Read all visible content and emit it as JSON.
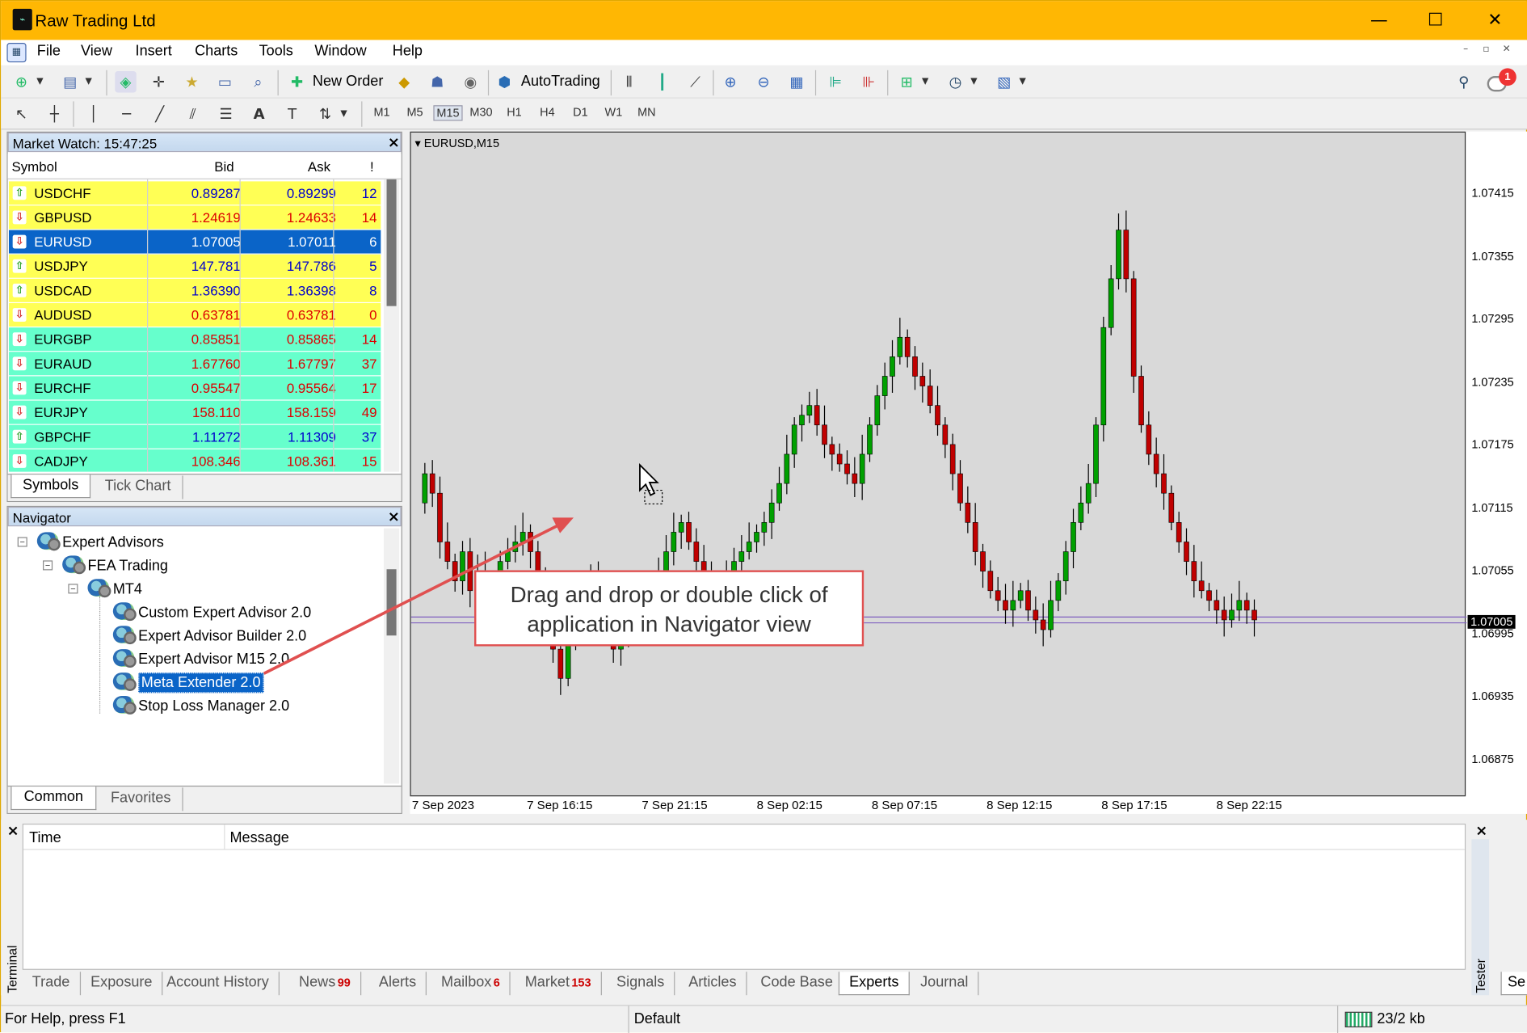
{
  "window": {
    "title": "Raw Trading Ltd",
    "minimize": "—",
    "maximize": "☐",
    "close": "✕"
  },
  "menu": [
    "File",
    "View",
    "Insert",
    "Charts",
    "Tools",
    "Window",
    "Help"
  ],
  "toolbar": {
    "new_order": "New Order",
    "autotrading": "AutoTrading",
    "notification_count": "1"
  },
  "timeframes": [
    "M1",
    "M5",
    "M15",
    "M30",
    "H1",
    "H4",
    "D1",
    "W1",
    "MN"
  ],
  "market_watch": {
    "title": "Market Watch: 15:47:25",
    "columns": {
      "symbol": "Symbol",
      "bid": "Bid",
      "ask": "Ask",
      "spread": "!"
    },
    "rows": [
      {
        "symbol": "USDCHF",
        "bid": "0.89287",
        "ask": "0.89299",
        "spread": "12",
        "dir": "up",
        "bg": "#ffff55",
        "color": "#0000cc"
      },
      {
        "symbol": "GBPUSD",
        "bid": "1.24619",
        "ask": "1.24633",
        "spread": "14",
        "dir": "down",
        "bg": "#ffff55",
        "color": "#dd0000"
      },
      {
        "symbol": "EURUSD",
        "bid": "1.07005",
        "ask": "1.07011",
        "spread": "6",
        "dir": "down",
        "bg": "#0a64c8",
        "color": "#ffffff"
      },
      {
        "symbol": "USDJPY",
        "bid": "147.781",
        "ask": "147.786",
        "spread": "5",
        "dir": "up",
        "bg": "#ffff55",
        "color": "#0000cc"
      },
      {
        "symbol": "USDCAD",
        "bid": "1.36390",
        "ask": "1.36398",
        "spread": "8",
        "dir": "up",
        "bg": "#ffff55",
        "color": "#0000cc"
      },
      {
        "symbol": "AUDUSD",
        "bid": "0.63781",
        "ask": "0.63781",
        "spread": "0",
        "dir": "down",
        "bg": "#ffff55",
        "color": "#dd0000"
      },
      {
        "symbol": "EURGBP",
        "bid": "0.85851",
        "ask": "0.85865",
        "spread": "14",
        "dir": "down",
        "bg": "#66ffcc",
        "color": "#dd0000"
      },
      {
        "symbol": "EURAUD",
        "bid": "1.67760",
        "ask": "1.67797",
        "spread": "37",
        "dir": "down",
        "bg": "#66ffcc",
        "color": "#dd0000"
      },
      {
        "symbol": "EURCHF",
        "bid": "0.95547",
        "ask": "0.95564",
        "spread": "17",
        "dir": "down",
        "bg": "#66ffcc",
        "color": "#dd0000"
      },
      {
        "symbol": "EURJPY",
        "bid": "158.110",
        "ask": "158.159",
        "spread": "49",
        "dir": "down",
        "bg": "#66ffcc",
        "color": "#dd0000"
      },
      {
        "symbol": "GBPCHF",
        "bid": "1.11272",
        "ask": "1.11309",
        "spread": "37",
        "dir": "up",
        "bg": "#66ffcc",
        "color": "#0000cc"
      },
      {
        "symbol": "CADJPY",
        "bid": "108.346",
        "ask": "108.361",
        "spread": "15",
        "dir": "down",
        "bg": "#66ffcc",
        "color": "#dd0000"
      }
    ],
    "tabs": [
      "Symbols",
      "Tick Chart"
    ]
  },
  "navigator": {
    "title": "Navigator",
    "root": "Expert Advisors",
    "folder": "FEA Trading",
    "subfolder": "MT4",
    "items": [
      "Custom Expert Advisor 2.0",
      "Expert Advisor Builder 2.0",
      "Expert Advisor M15 2.0",
      "Meta Extender 2.0",
      "Stop Loss Manager 2.0"
    ],
    "selected": "Meta Extender 2.0",
    "tabs": [
      "Common",
      "Favorites"
    ]
  },
  "chart": {
    "title": "EURUSD,M15",
    "price_labels": [
      "1.07415",
      "1.07355",
      "1.07295",
      "1.07235",
      "1.07175",
      "1.07115",
      "1.07055",
      "1.06995",
      "1.06935",
      "1.06875"
    ],
    "current_price": "1.07005",
    "time_labels": [
      "7 Sep 2023",
      "7 Sep 16:15",
      "7 Sep 21:15",
      "8 Sep 02:15",
      "8 Sep 07:15",
      "8 Sep 12:15",
      "8 Sep 17:15",
      "8 Sep 22:15"
    ],
    "bull_color": "#00a000",
    "bear_color": "#c00000",
    "callout": "Drag and drop or double click of application in Navigator view"
  },
  "terminal": {
    "columns": {
      "time": "Time",
      "message": "Message"
    },
    "label": "Terminal",
    "tester_label": "Tester",
    "tabs": [
      {
        "label": "Trade",
        "badge": ""
      },
      {
        "label": "Exposure",
        "badge": ""
      },
      {
        "label": "Account History",
        "badge": ""
      },
      {
        "label": "News",
        "badge": "99"
      },
      {
        "label": "Alerts",
        "badge": ""
      },
      {
        "label": "Mailbox",
        "badge": "6"
      },
      {
        "label": "Market",
        "badge": "153"
      },
      {
        "label": "Signals",
        "badge": ""
      },
      {
        "label": "Articles",
        "badge": ""
      },
      {
        "label": "Code Base",
        "badge": ""
      },
      {
        "label": "Experts",
        "badge": ""
      },
      {
        "label": "Journal",
        "badge": ""
      }
    ],
    "active_tab": "Experts",
    "tester_tab": "Se"
  },
  "status": {
    "help": "For Help, press F1",
    "profile": "Default",
    "traffic": "23/2 kb"
  }
}
